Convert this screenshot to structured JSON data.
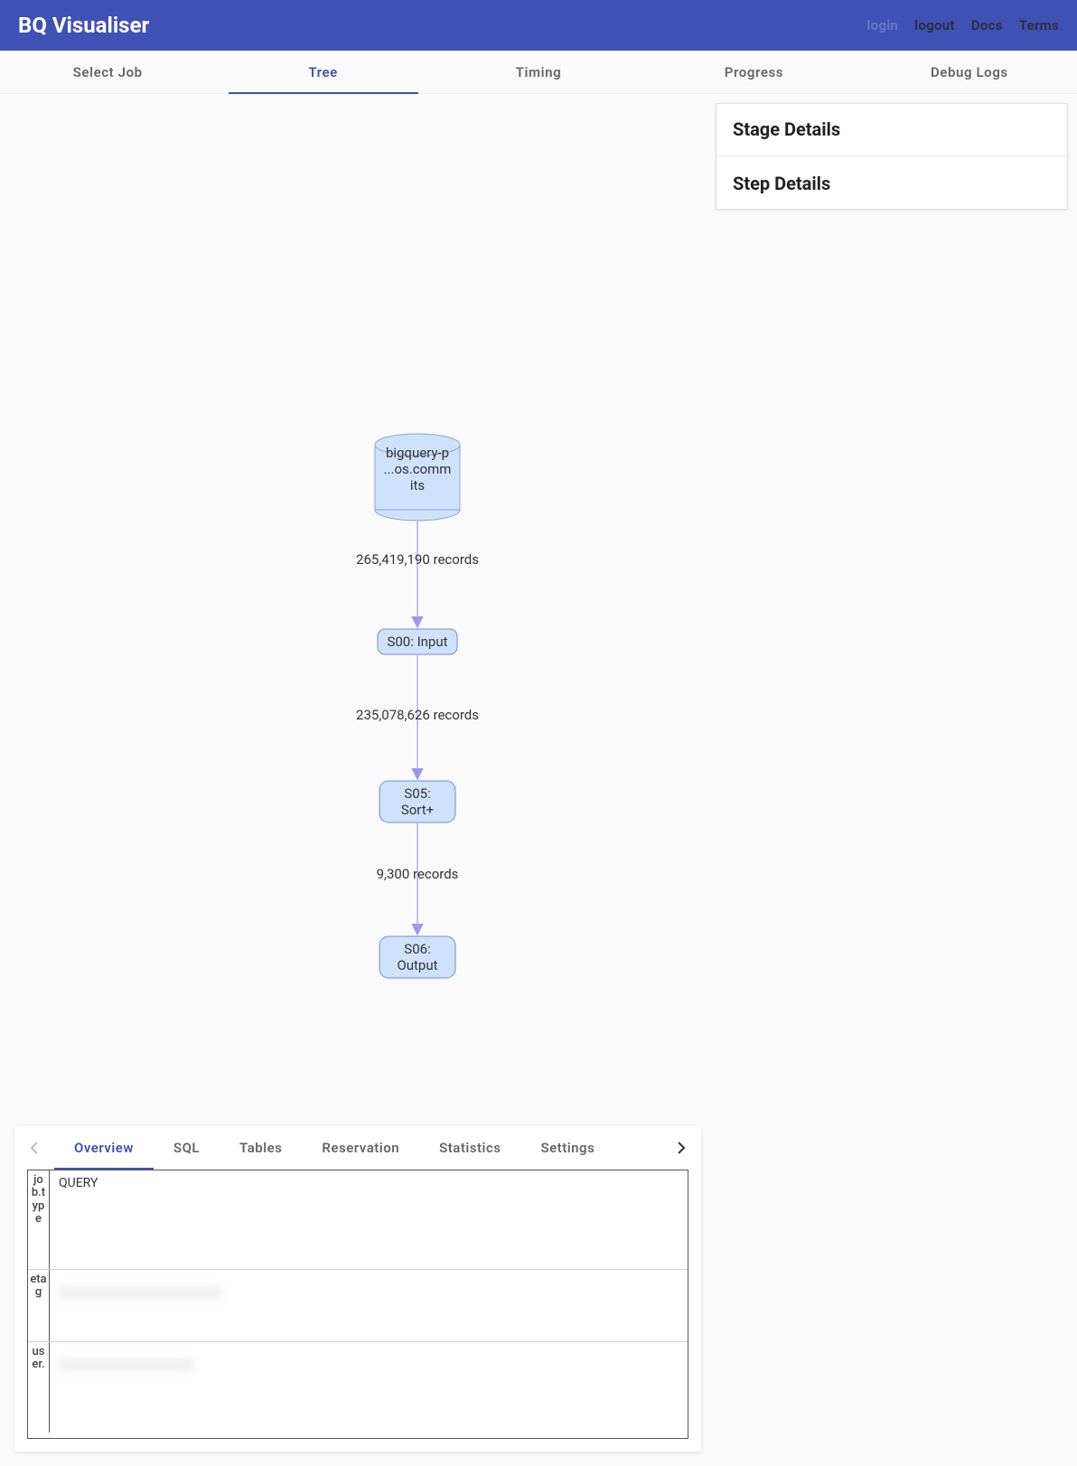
{
  "header": {
    "title": "BQ Visualiser",
    "links": {
      "login": "login",
      "logout": "logout",
      "docs": "Docs",
      "terms": "Terms"
    }
  },
  "main_tabs": {
    "select_job": "Select Job",
    "tree": "Tree",
    "timing": "Timing",
    "progress": "Progress",
    "debug_logs": "Debug Logs"
  },
  "details": {
    "stage_title": "Stage Details",
    "step_title": "Step Details"
  },
  "tree": {
    "source": {
      "line1": "bigquery-p",
      "line2": "...os.comm",
      "line3": "its"
    },
    "edge1_label": "265,419,190 records",
    "node_s00": "S00: Input",
    "edge2_label": "235,078,626 records",
    "node_s05_l1": "S05:",
    "node_s05_l2": "Sort+",
    "edge3_label": "9,300 records",
    "node_s06_l1": "S06:",
    "node_s06_l2": "Output"
  },
  "bottom_tabs": {
    "overview": "Overview",
    "sql": "SQL",
    "tables": "Tables",
    "reservation": "Reservation",
    "statistics": "Statistics",
    "settings": "Settings"
  },
  "overview_grid": {
    "row1_label": "job.type",
    "row1_value": "QUERY",
    "row2_label": "etag",
    "row3_label": "user."
  }
}
